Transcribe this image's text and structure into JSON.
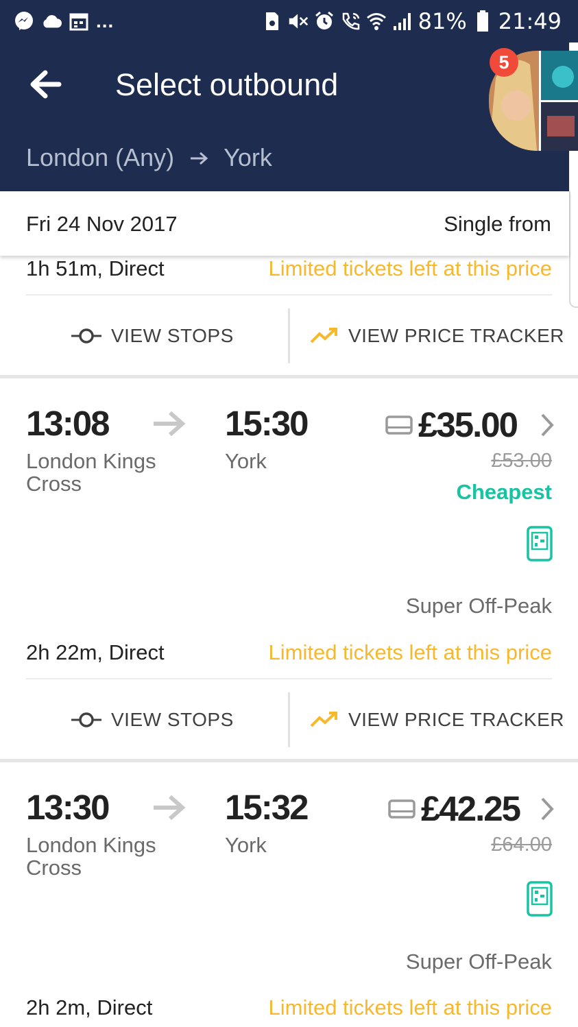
{
  "status_bar": {
    "left_icons": [
      "messenger-icon",
      "cloud-icon",
      "calendar-icon"
    ],
    "more": "...",
    "right_icons": [
      "sim-icon",
      "mute-icon",
      "alarm-icon",
      "wifi-call-icon",
      "wifi-icon",
      "signal-icon"
    ],
    "battery": "81%",
    "time": "21:49"
  },
  "header": {
    "title": "Select outbound",
    "origin": "London (Any)",
    "destination": "York",
    "notification_count": "5"
  },
  "date_bar": {
    "date": "Fri 24 Nov 2017",
    "single_from": "Single from"
  },
  "partial_row": {
    "duration": "1h 51m, Direct",
    "limited": "Limited tickets left at this price",
    "view_stops": "VIEW STOPS",
    "view_price_tracker": "VIEW PRICE TRACKER"
  },
  "journeys": [
    {
      "depart_time": "13:08",
      "depart_station": "London Kings Cross",
      "arrive_time": "15:30",
      "arrive_station": "York",
      "price": "£35.00",
      "old_price": "£53.00",
      "tag": "Cheapest",
      "fare_type": "Super Off-Peak",
      "duration": "2h 22m, Direct",
      "limited": "Limited tickets left at this price",
      "view_stops": "VIEW STOPS",
      "view_price_tracker": "VIEW PRICE TRACKER"
    },
    {
      "depart_time": "13:30",
      "depart_station": "London Kings Cross",
      "arrive_time": "15:32",
      "arrive_station": "York",
      "price": "£42.25",
      "old_price": "£64.00",
      "fare_type": "Super Off-Peak",
      "duration": "2h 2m, Direct",
      "limited": "Limited tickets left at this price"
    }
  ],
  "colors": {
    "header_bg": "#1e2d4f",
    "limited": "#f7b82c",
    "cheapest": "#18c3a4",
    "badge": "#f04a3a"
  }
}
